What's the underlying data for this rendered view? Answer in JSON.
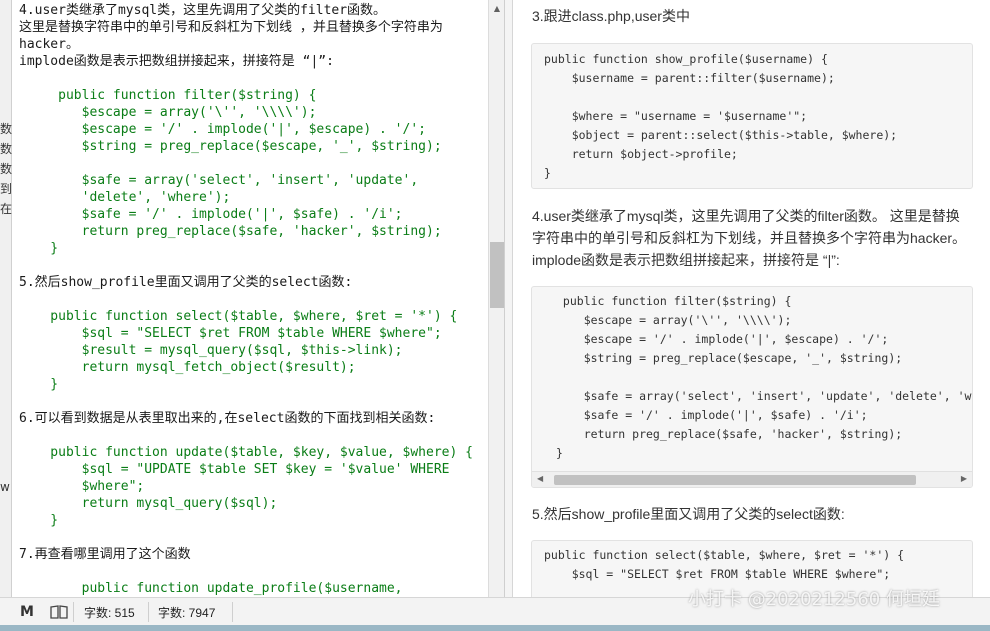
{
  "left_sliver": {
    "chars": [
      "数",
      "数",
      "数",
      "到",
      "在",
      "w"
    ]
  },
  "editor": {
    "lines": [
      {
        "t": "4.user类继承了mysql类，这里先调用了父类的filter函数。",
        "code": false
      },
      {
        "t": "这里是替换字符串中的单引号和反斜杠为下划线 ，并且替换多个字符串为",
        "code": false
      },
      {
        "t": "hacker。",
        "code": false
      },
      {
        "t": "implode函数是表示把数组拼接起来，拼接符是 “|”:",
        "code": false
      },
      {
        "t": "",
        "code": false
      },
      {
        "t": "     public function filter($string) {",
        "code": true
      },
      {
        "t": "        $escape = array('\\'', '\\\\\\\\');",
        "code": true
      },
      {
        "t": "        $escape = '/' . implode('|', $escape) . '/';",
        "code": true
      },
      {
        "t": "        $string = preg_replace($escape, '_', $string);",
        "code": true
      },
      {
        "t": "",
        "code": false
      },
      {
        "t": "        $safe = array('select', 'insert', 'update',",
        "code": true
      },
      {
        "t": "        'delete', 'where');",
        "code": true
      },
      {
        "t": "        $safe = '/' . implode('|', $safe) . '/i';",
        "code": true
      },
      {
        "t": "        return preg_replace($safe, 'hacker', $string);",
        "code": true
      },
      {
        "t": "    }",
        "code": true
      },
      {
        "t": "",
        "code": false
      },
      {
        "t": "5.然后show_profile里面又调用了父类的select函数:",
        "code": false
      },
      {
        "t": "",
        "code": false
      },
      {
        "t": "    public function select($table, $where, $ret = '*') {",
        "code": true
      },
      {
        "t": "        $sql = \"SELECT $ret FROM $table WHERE $where\";",
        "code": true
      },
      {
        "t": "        $result = mysql_query($sql, $this->link);",
        "code": true
      },
      {
        "t": "        return mysql_fetch_object($result);",
        "code": true
      },
      {
        "t": "    }",
        "code": true
      },
      {
        "t": "",
        "code": false
      },
      {
        "t": "6.可以看到数据是从表里取出来的,在select函数的下面找到相关函数:",
        "code": false
      },
      {
        "t": "",
        "code": false
      },
      {
        "t": "    public function update($table, $key, $value, $where) {",
        "code": true
      },
      {
        "t": "        $sql = \"UPDATE $table SET $key = '$value' WHERE",
        "code": true
      },
      {
        "t": "        $where\";",
        "code": true
      },
      {
        "t": "        return mysql_query($sql);",
        "code": true
      },
      {
        "t": "    }",
        "code": true
      },
      {
        "t": "",
        "code": false
      },
      {
        "t": "7.再查看哪里调用了这个函数",
        "code": false
      },
      {
        "t": "",
        "code": false
      },
      {
        "t": "        public function update_profile($username,",
        "code": true
      }
    ]
  },
  "preview": {
    "para3": "3.跟进class.php,user类中",
    "code1": [
      "public function show_profile($username) {",
      "    $username = parent::filter($username);",
      "",
      "    $where = \"username = '$username'\";",
      "    $object = parent::select($this->table, $where);",
      "    return $object->profile;",
      "}"
    ],
    "para4_l1": "4.user类继承了mysql类，这里先调用了父类的filter函数。 这里是替换",
    "para4_l2": "字符串中的单引号和反斜杠为下划线，并且替换多个字符串为hacker。",
    "para4_l3": "implode函数是表示把数组拼接起来，拼接符是 “|”:",
    "code2": [
      " public function filter($string) {",
      "    $escape = array('\\'', '\\\\\\\\');",
      "    $escape = '/' . implode('|', $escape) . '/';",
      "    $string = preg_replace($escape, '_', $string);",
      "",
      "    $safe = array('select', 'insert', 'update', 'delete', 'where');",
      "    $safe = '/' . implode('|', $safe) . '/i';",
      "    return preg_replace($safe, 'hacker', $string);",
      "}"
    ],
    "para5": "5.然后show_profile里面又调用了父类的select函数:",
    "code3": [
      "public function select($table, $where, $ret = '*') {",
      "    $sql = \"SELECT $ret FROM $table WHERE $where\";"
    ]
  },
  "statusbar": {
    "mode_icon": "markdown-icon",
    "read_icon": "book-icon",
    "word_count": "字数: 515",
    "char_count": "字数: 7947"
  },
  "watermark": "小打卡 @2020212560 何垣廷"
}
